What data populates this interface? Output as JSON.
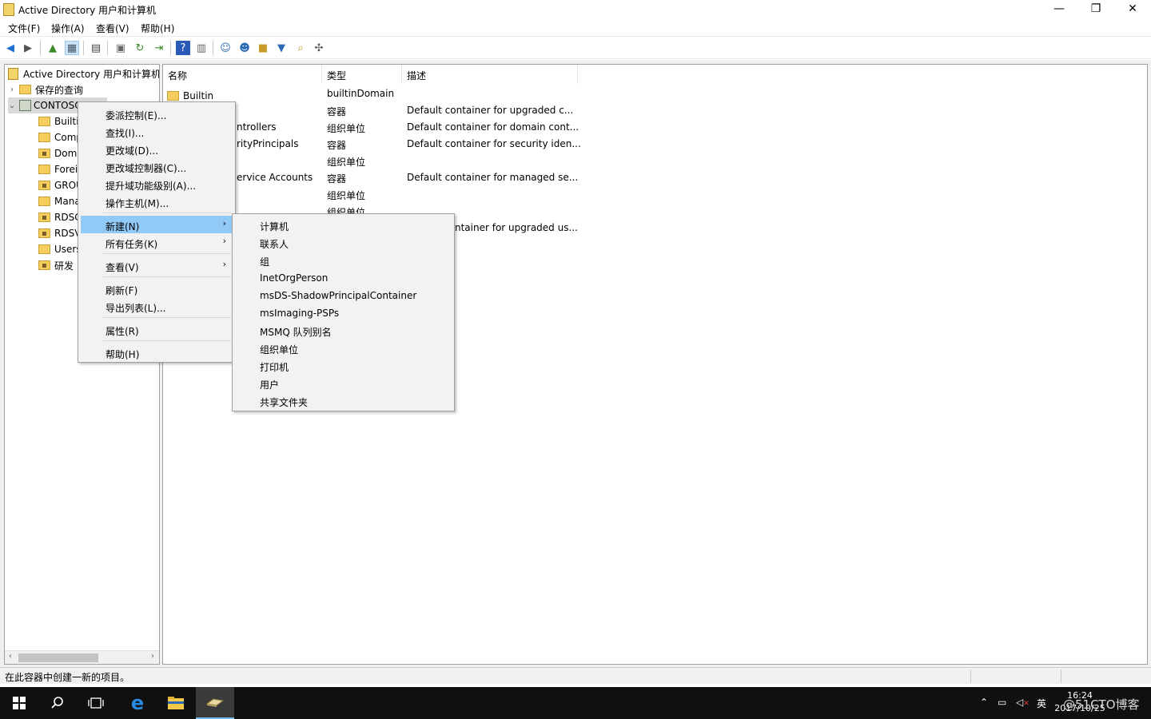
{
  "window": {
    "title": "Active Directory 用户和计算机",
    "min_glyph": "—",
    "max_glyph": "❐",
    "close_glyph": "✕"
  },
  "menubar": [
    "文件(F)",
    "操作(A)",
    "查看(V)",
    "帮助(H)"
  ],
  "tree": {
    "root": "Active Directory 用户和计算机",
    "saved_queries": "保存的查询",
    "domain": "CONTOSO.COM",
    "children": [
      "Builti",
      "Comp",
      "Dom",
      "Forei",
      "GROU",
      "Mana",
      "RDSC",
      "RDSV",
      "Users",
      "研发"
    ]
  },
  "list": {
    "columns": [
      "名称",
      "类型",
      "描述"
    ],
    "rows": [
      {
        "name": "Builtin",
        "type": "builtinDomain",
        "desc": ""
      },
      {
        "name": "",
        "type": "容器",
        "desc": "Default container for upgraded c..."
      },
      {
        "name": "ntrollers",
        "type": "组织单位",
        "desc": "Default container for domain cont..."
      },
      {
        "name": "rityPrincipals",
        "type": "容器",
        "desc": "Default container for security iden..."
      },
      {
        "name": "",
        "type": "组织单位",
        "desc": ""
      },
      {
        "name": "ervice Accounts",
        "type": "容器",
        "desc": "Default container for managed se..."
      },
      {
        "name": "",
        "type": "组织单位",
        "desc": ""
      },
      {
        "name": "",
        "type": "组织单位",
        "desc": ""
      },
      {
        "name": "",
        "type": "",
        "desc": "ntainer for upgraded us..."
      }
    ]
  },
  "context_menu": {
    "items": [
      "委派控制(E)...",
      "查找(I)...",
      "更改域(D)...",
      "更改域控制器(C)...",
      "提升域功能级别(A)...",
      "操作主机(M)...",
      "新建(N)",
      "所有任务(K)",
      "查看(V)",
      "刷新(F)",
      "导出列表(L)...",
      "属性(R)",
      "帮助(H)"
    ],
    "submenu_arrow": "›"
  },
  "new_submenu": [
    "计算机",
    "联系人",
    "组",
    "InetOrgPerson",
    "msDS-ShadowPrincipalContainer",
    "msImaging-PSPs",
    "MSMQ 队列别名",
    "组织单位",
    "打印机",
    "用户",
    "共享文件夹"
  ],
  "status": "在此容器中创建一新的项目。",
  "taskbar": {
    "tray_input": "英",
    "time": "16:24",
    "date": "2017/10/25",
    "watermark": "@51CTO博客"
  }
}
